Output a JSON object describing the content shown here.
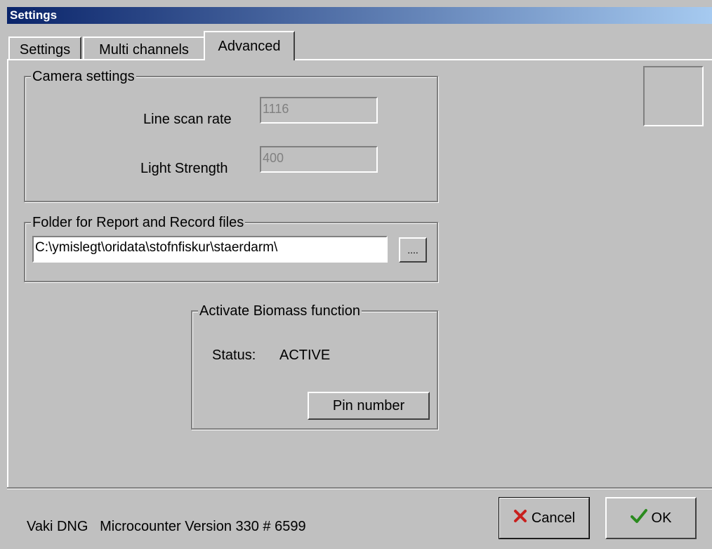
{
  "window": {
    "title": "Settings"
  },
  "tabs": [
    {
      "label": "Settings"
    },
    {
      "label": "Multi channels"
    },
    {
      "label": "Advanced"
    }
  ],
  "camera": {
    "legend": "Camera settings",
    "line_scan_label": "Line scan rate",
    "line_scan_value": "1116",
    "light_label": "Light Strength",
    "light_value": "400"
  },
  "folder": {
    "legend": "Folder for Report and Record files",
    "path": "C:\\ymislegt\\oridata\\stofnfiskur\\staerdarm\\",
    "browse_label": "...."
  },
  "biomass": {
    "legend": "Activate Biomass function",
    "status_label": "Status:",
    "status_value": "ACTIVE",
    "pin_button": "Pin number"
  },
  "footer": {
    "version_text": "Vaki DNG   Microcounter Version 330 # 6599",
    "cancel_label": "Cancel",
    "ok_label": "OK",
    "cancel_icon": "x-icon",
    "ok_icon": "checkmark-icon"
  }
}
